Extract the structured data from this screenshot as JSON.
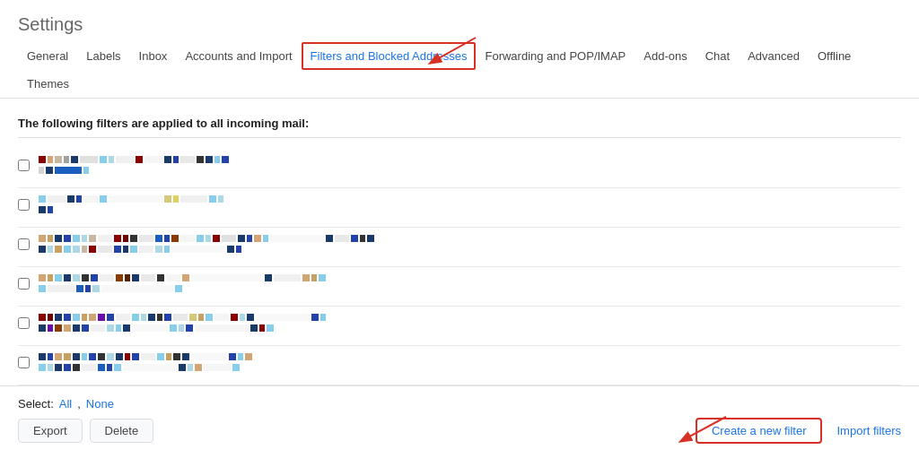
{
  "page": {
    "title": "Settings"
  },
  "nav": {
    "tabs": [
      {
        "id": "general",
        "label": "General",
        "active": false
      },
      {
        "id": "labels",
        "label": "Labels",
        "active": false
      },
      {
        "id": "inbox",
        "label": "Inbox",
        "active": false
      },
      {
        "id": "accounts",
        "label": "Accounts and Import",
        "active": false
      },
      {
        "id": "filters",
        "label": "Filters and Blocked Addresses",
        "active": true
      },
      {
        "id": "forwarding",
        "label": "Forwarding and POP/IMAP",
        "active": false
      },
      {
        "id": "addons",
        "label": "Add-ons",
        "active": false
      },
      {
        "id": "chat",
        "label": "Chat",
        "active": false
      },
      {
        "id": "advanced",
        "label": "Advanced",
        "active": false
      },
      {
        "id": "offline",
        "label": "Offline",
        "active": false
      },
      {
        "id": "themes",
        "label": "Themes",
        "active": false
      }
    ]
  },
  "content": {
    "filters_header": "The following filters are applied to all incoming mail:"
  },
  "footer": {
    "select_label": "Select:",
    "all_link": "All",
    "none_link": "None",
    "export_btn": "Export",
    "delete_btn": "Delete",
    "create_filter_btn": "Create a new filter",
    "import_link": "Import filters"
  }
}
